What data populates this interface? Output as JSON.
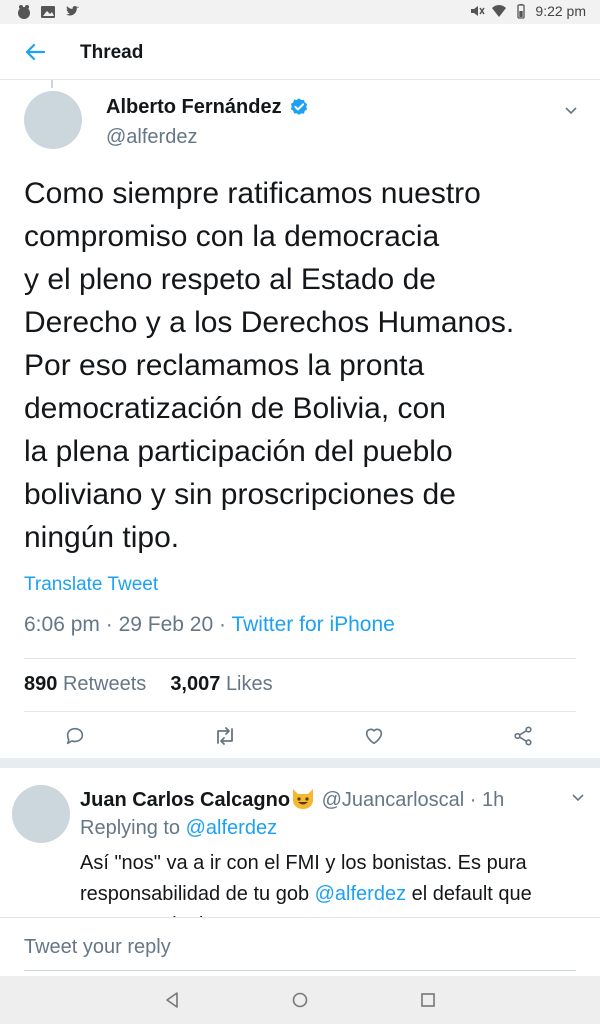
{
  "statusbar": {
    "time": "9:22 pm",
    "left_icons": [
      "app-notification-icon",
      "image-icon",
      "twitter-bird-icon"
    ],
    "right_icons": [
      "mute-icon",
      "wifi-icon",
      "battery-icon"
    ]
  },
  "appbar": {
    "back_icon": "arrow-left-icon",
    "title": "Thread"
  },
  "tweet": {
    "author_name": "Alberto Fernández",
    "verified_icon": "verified-badge-icon",
    "handle": "@alferdez",
    "text": "Como siempre ratificamos nuestro\ncompromiso con la democracia\ny el pleno respeto al Estado de\nDerecho y a los Derechos Humanos.\nPor eso reclamamos la pronta\ndemocratización de Bolivia, con\nla plena participación del pueblo\nboliviano y sin proscripciones de\nningún tipo.",
    "translate_label": "Translate Tweet",
    "time": "6:06 pm",
    "date": "29 Feb 20",
    "source": "Twitter for iPhone",
    "retweets_count": "890",
    "retweets_label": "Retweets",
    "likes_count": "3,007",
    "likes_label": "Likes",
    "actions": [
      "reply-icon",
      "retweet-icon",
      "like-icon",
      "share-icon"
    ]
  },
  "reply": {
    "author_name": "Juan Carlos Calcagno",
    "emoji_icon": "grinning-cat-emoji-icon",
    "handle": "@Juancarloscal",
    "time": "1h",
    "replying_to_label": "Replying to",
    "replying_to_handle": "@alferdez",
    "text_part1": "Así \"nos\" va a ir con el FMI y los bonistas. Es pura responsabilidad de tu gob",
    "text_mention": "@alferdez",
    "text_part2": "el default que vamos a elegir"
  },
  "composer": {
    "placeholder": "Tweet your reply"
  },
  "colors": {
    "accent": "#1da1f2",
    "muted": "#657786",
    "text": "#14171a",
    "border": "#e1e8ed"
  }
}
